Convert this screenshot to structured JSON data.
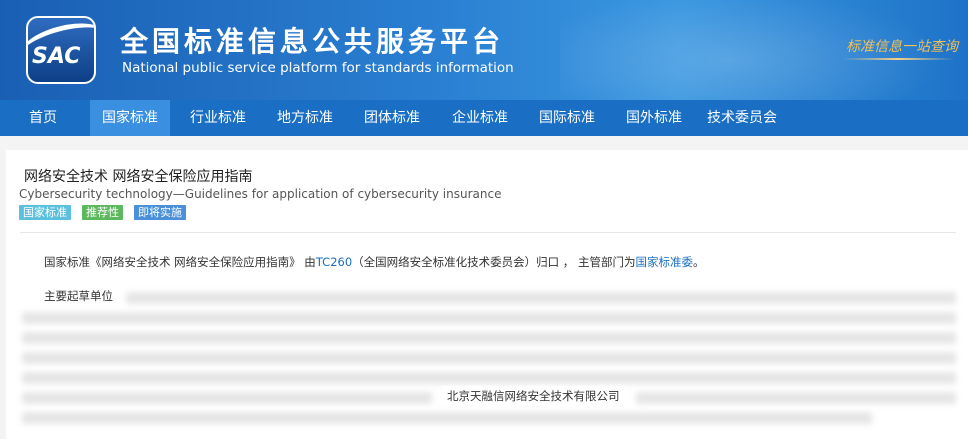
{
  "header": {
    "logo_text": "SAC",
    "title_cn": "全国标准信息公共服务平台",
    "title_en": "National public service platform  for standards information",
    "slogan": "标准信息一站查询"
  },
  "nav": {
    "items": [
      {
        "label": "首页"
      },
      {
        "label": "国家标准"
      },
      {
        "label": "行业标准"
      },
      {
        "label": "地方标准"
      },
      {
        "label": "团体标准"
      },
      {
        "label": "企业标准"
      },
      {
        "label": "国际标准"
      },
      {
        "label": "国外标准"
      },
      {
        "label": "技术委员会"
      }
    ],
    "active": "国家标准"
  },
  "standard": {
    "title_cn": "网络安全技术 网络安全保险应用指南",
    "title_en": "Cybersecurity technology—Guidelines for application of cybersecurity insurance",
    "badges": [
      {
        "label": "国家标准",
        "color": "#5bc0de"
      },
      {
        "label": "推荐性",
        "color": "#5cb85c"
      },
      {
        "label": "即将实施",
        "color": "#4a90d9"
      }
    ],
    "desc_prefix": "国家标准《网络安全技术 网络安全保险应用指南》 由",
    "tc_link": "TC260",
    "desc_mid": "（全国网络安全标准化技术委员会）归口 ， 主管部门为",
    "dept_link": "国家标准委",
    "desc_suffix": "。",
    "drafters_label": "主要起草单位",
    "visible_drafter": "北京天融信网络安全技术有限公司"
  },
  "colors": {
    "header_blue": "#1a5fb4",
    "nav_blue": "#1a6fc4",
    "nav_active": "#3a8fe0",
    "link_blue": "#1a6fc4"
  }
}
